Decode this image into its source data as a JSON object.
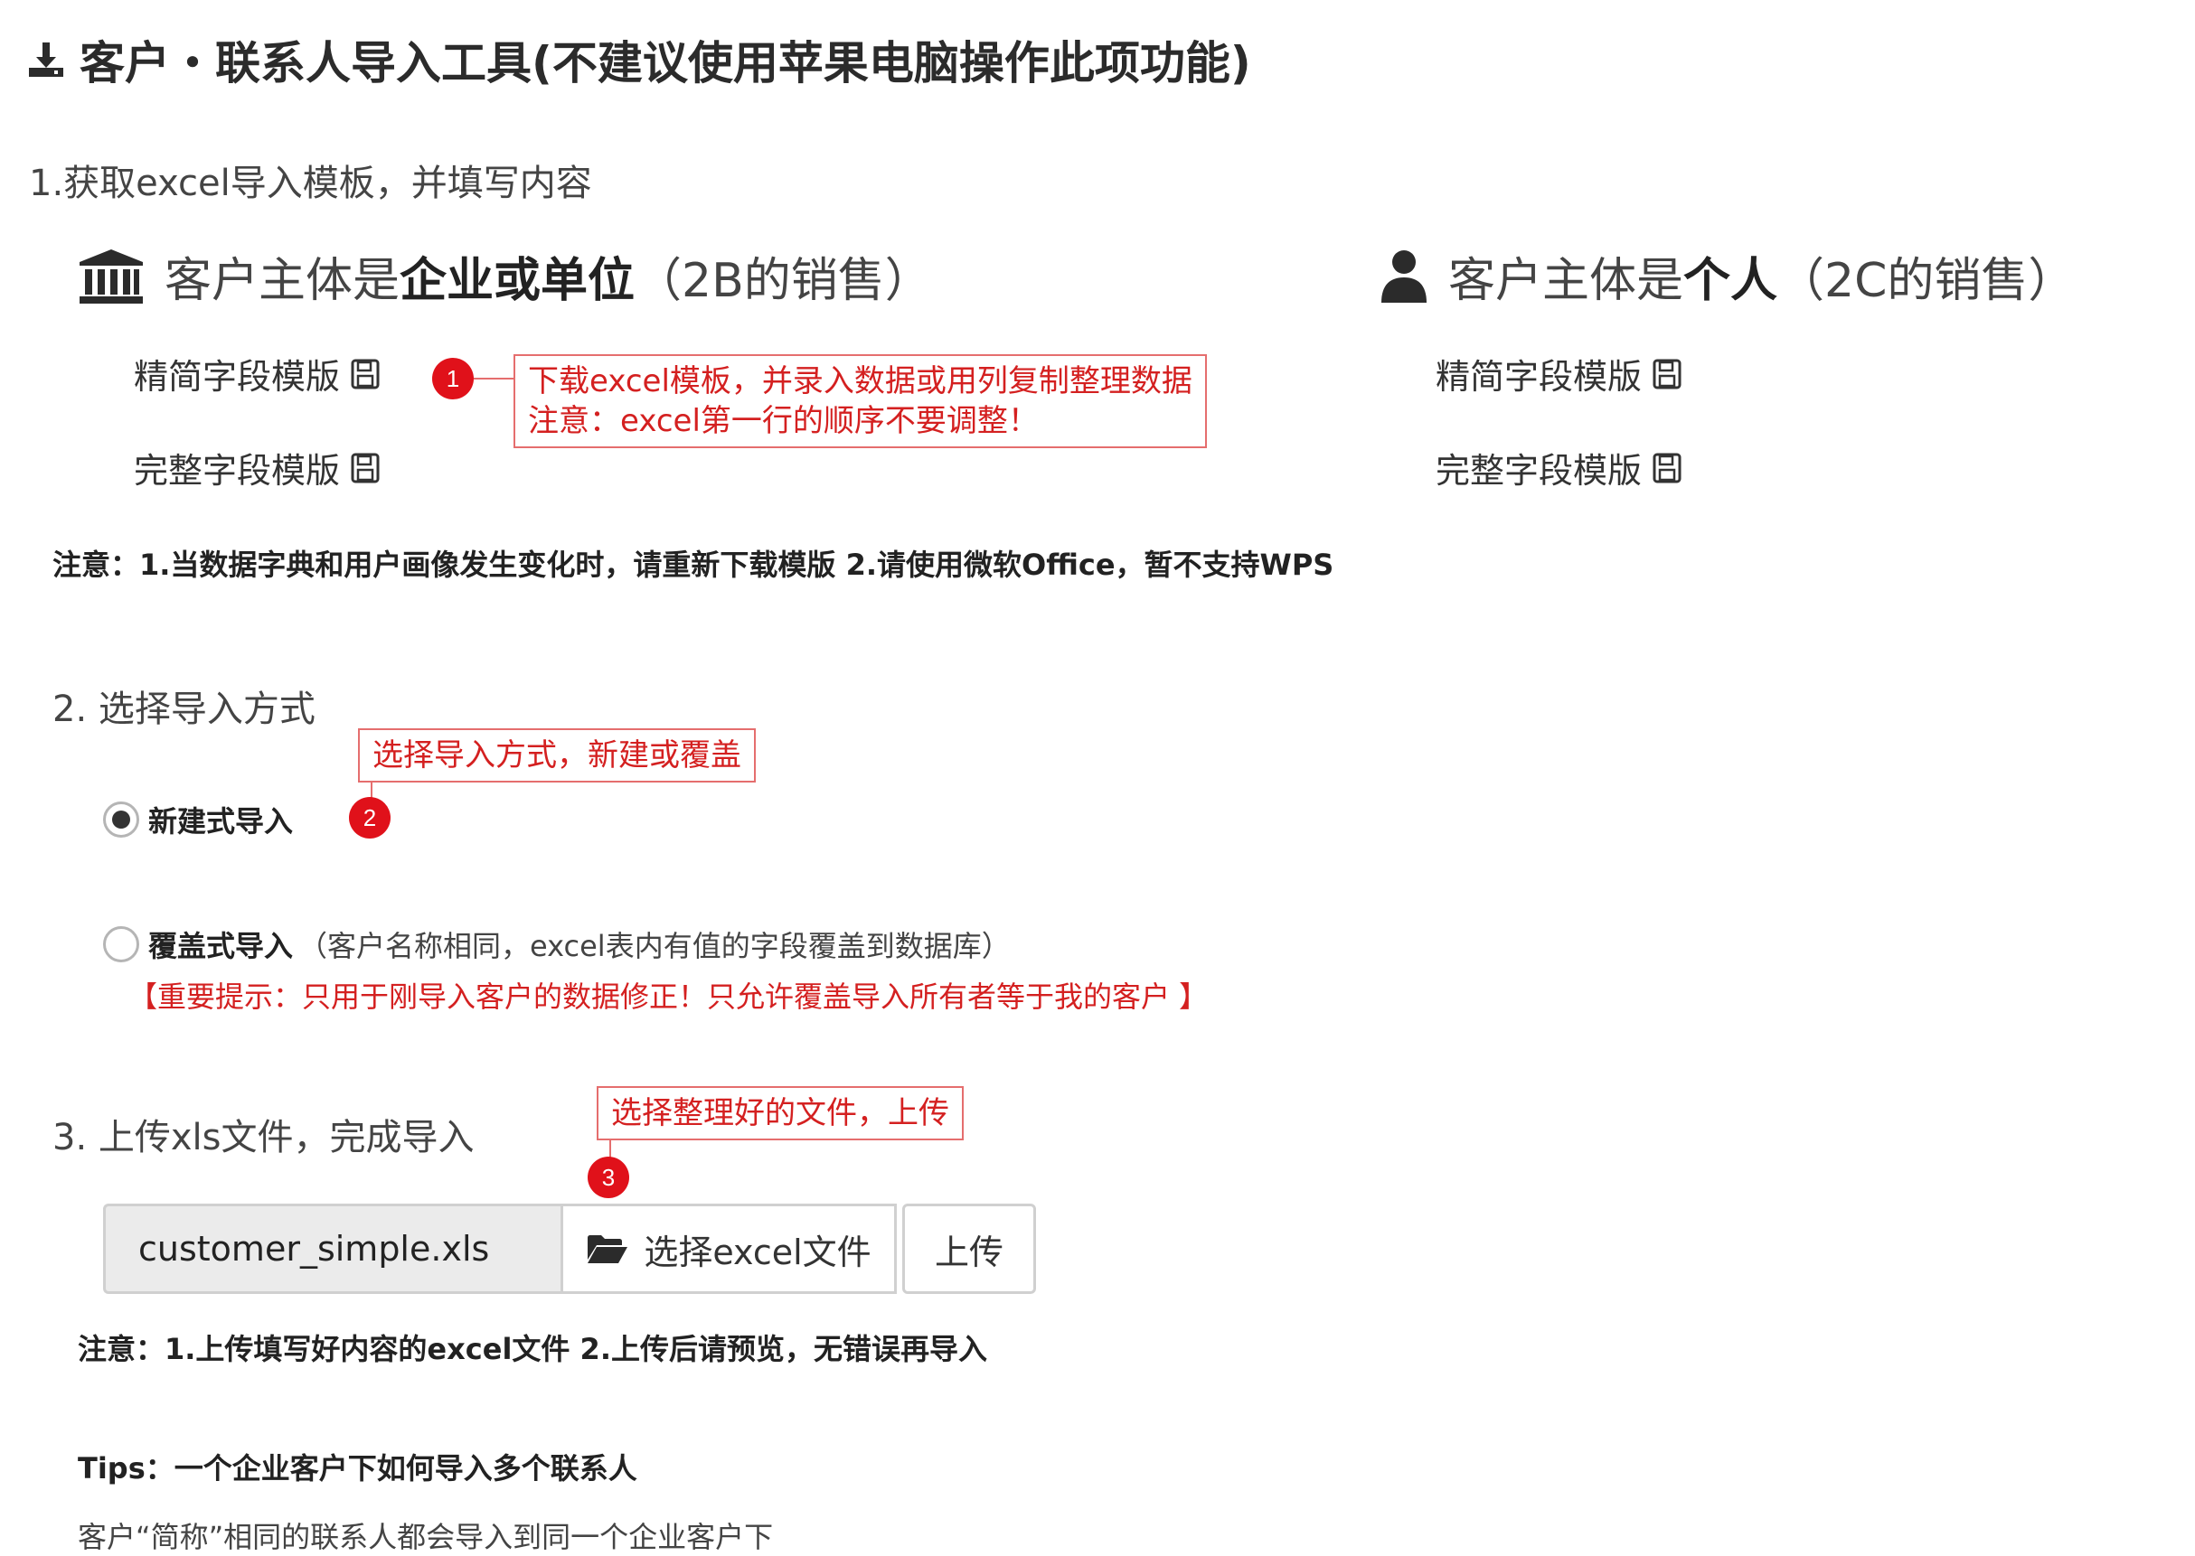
{
  "header": {
    "title": "客户・联系人导入工具(不建议使用苹果电脑操作此项功能)",
    "icon": "download-icon"
  },
  "step1": {
    "title": "1.获取excel导入模板，并填写内容",
    "enterprise": {
      "prefix": "客户主体是",
      "bold": "企业或单位",
      "suffix": "（2B的销售）",
      "icon": "bank-icon",
      "simple_template": "精简字段模版",
      "full_template": "完整字段模版"
    },
    "individual": {
      "prefix": "客户主体是",
      "bold": "个人",
      "suffix": "（2C的销售）",
      "icon": "user-icon",
      "simple_template": "精简字段模版",
      "full_template": "完整字段模版"
    },
    "note": "注意：1.当数据字典和用户画像发生变化时，请重新下载模版 2.请使用微软Office，暂不支持WPS"
  },
  "annotations": {
    "a1": {
      "number": "1",
      "line1": "下载excel模板，并录入数据或用列复制整理数据",
      "line2": "注意：excel第一行的顺序不要调整！"
    },
    "a2": {
      "number": "2",
      "text": "选择导入方式，新建或覆盖"
    },
    "a3": {
      "number": "3",
      "text": "选择整理好的文件，上传"
    }
  },
  "step2": {
    "title": "2. 选择导入方式",
    "option_new": {
      "label": "新建式导入",
      "checked": true
    },
    "option_overwrite": {
      "label": "覆盖式导入",
      "desc": "（客户名称相同，excel表内有值的字段覆盖到数据库）",
      "checked": false
    },
    "warning": "【重要提示：只用于刚导入客户的数据修正！只允许覆盖导入所有者等于我的客户 】"
  },
  "step3": {
    "title": "3. 上传xls文件，完成导入",
    "file_name": "customer_simple.xls",
    "choose_button": "选择excel文件",
    "upload_button": "上传",
    "note": "注意：1.上传填写好内容的excel文件 2.上传后请预览，无错误再导入"
  },
  "tips": {
    "title": "Tips：一个企业客户下如何导入多个联系人",
    "body": "客户“简称”相同的联系人都会导入到同一个企业客户下"
  },
  "colors": {
    "annotation_red": "#e0111a",
    "annotation_border": "#e56e6e",
    "warning_red": "#d42020"
  }
}
